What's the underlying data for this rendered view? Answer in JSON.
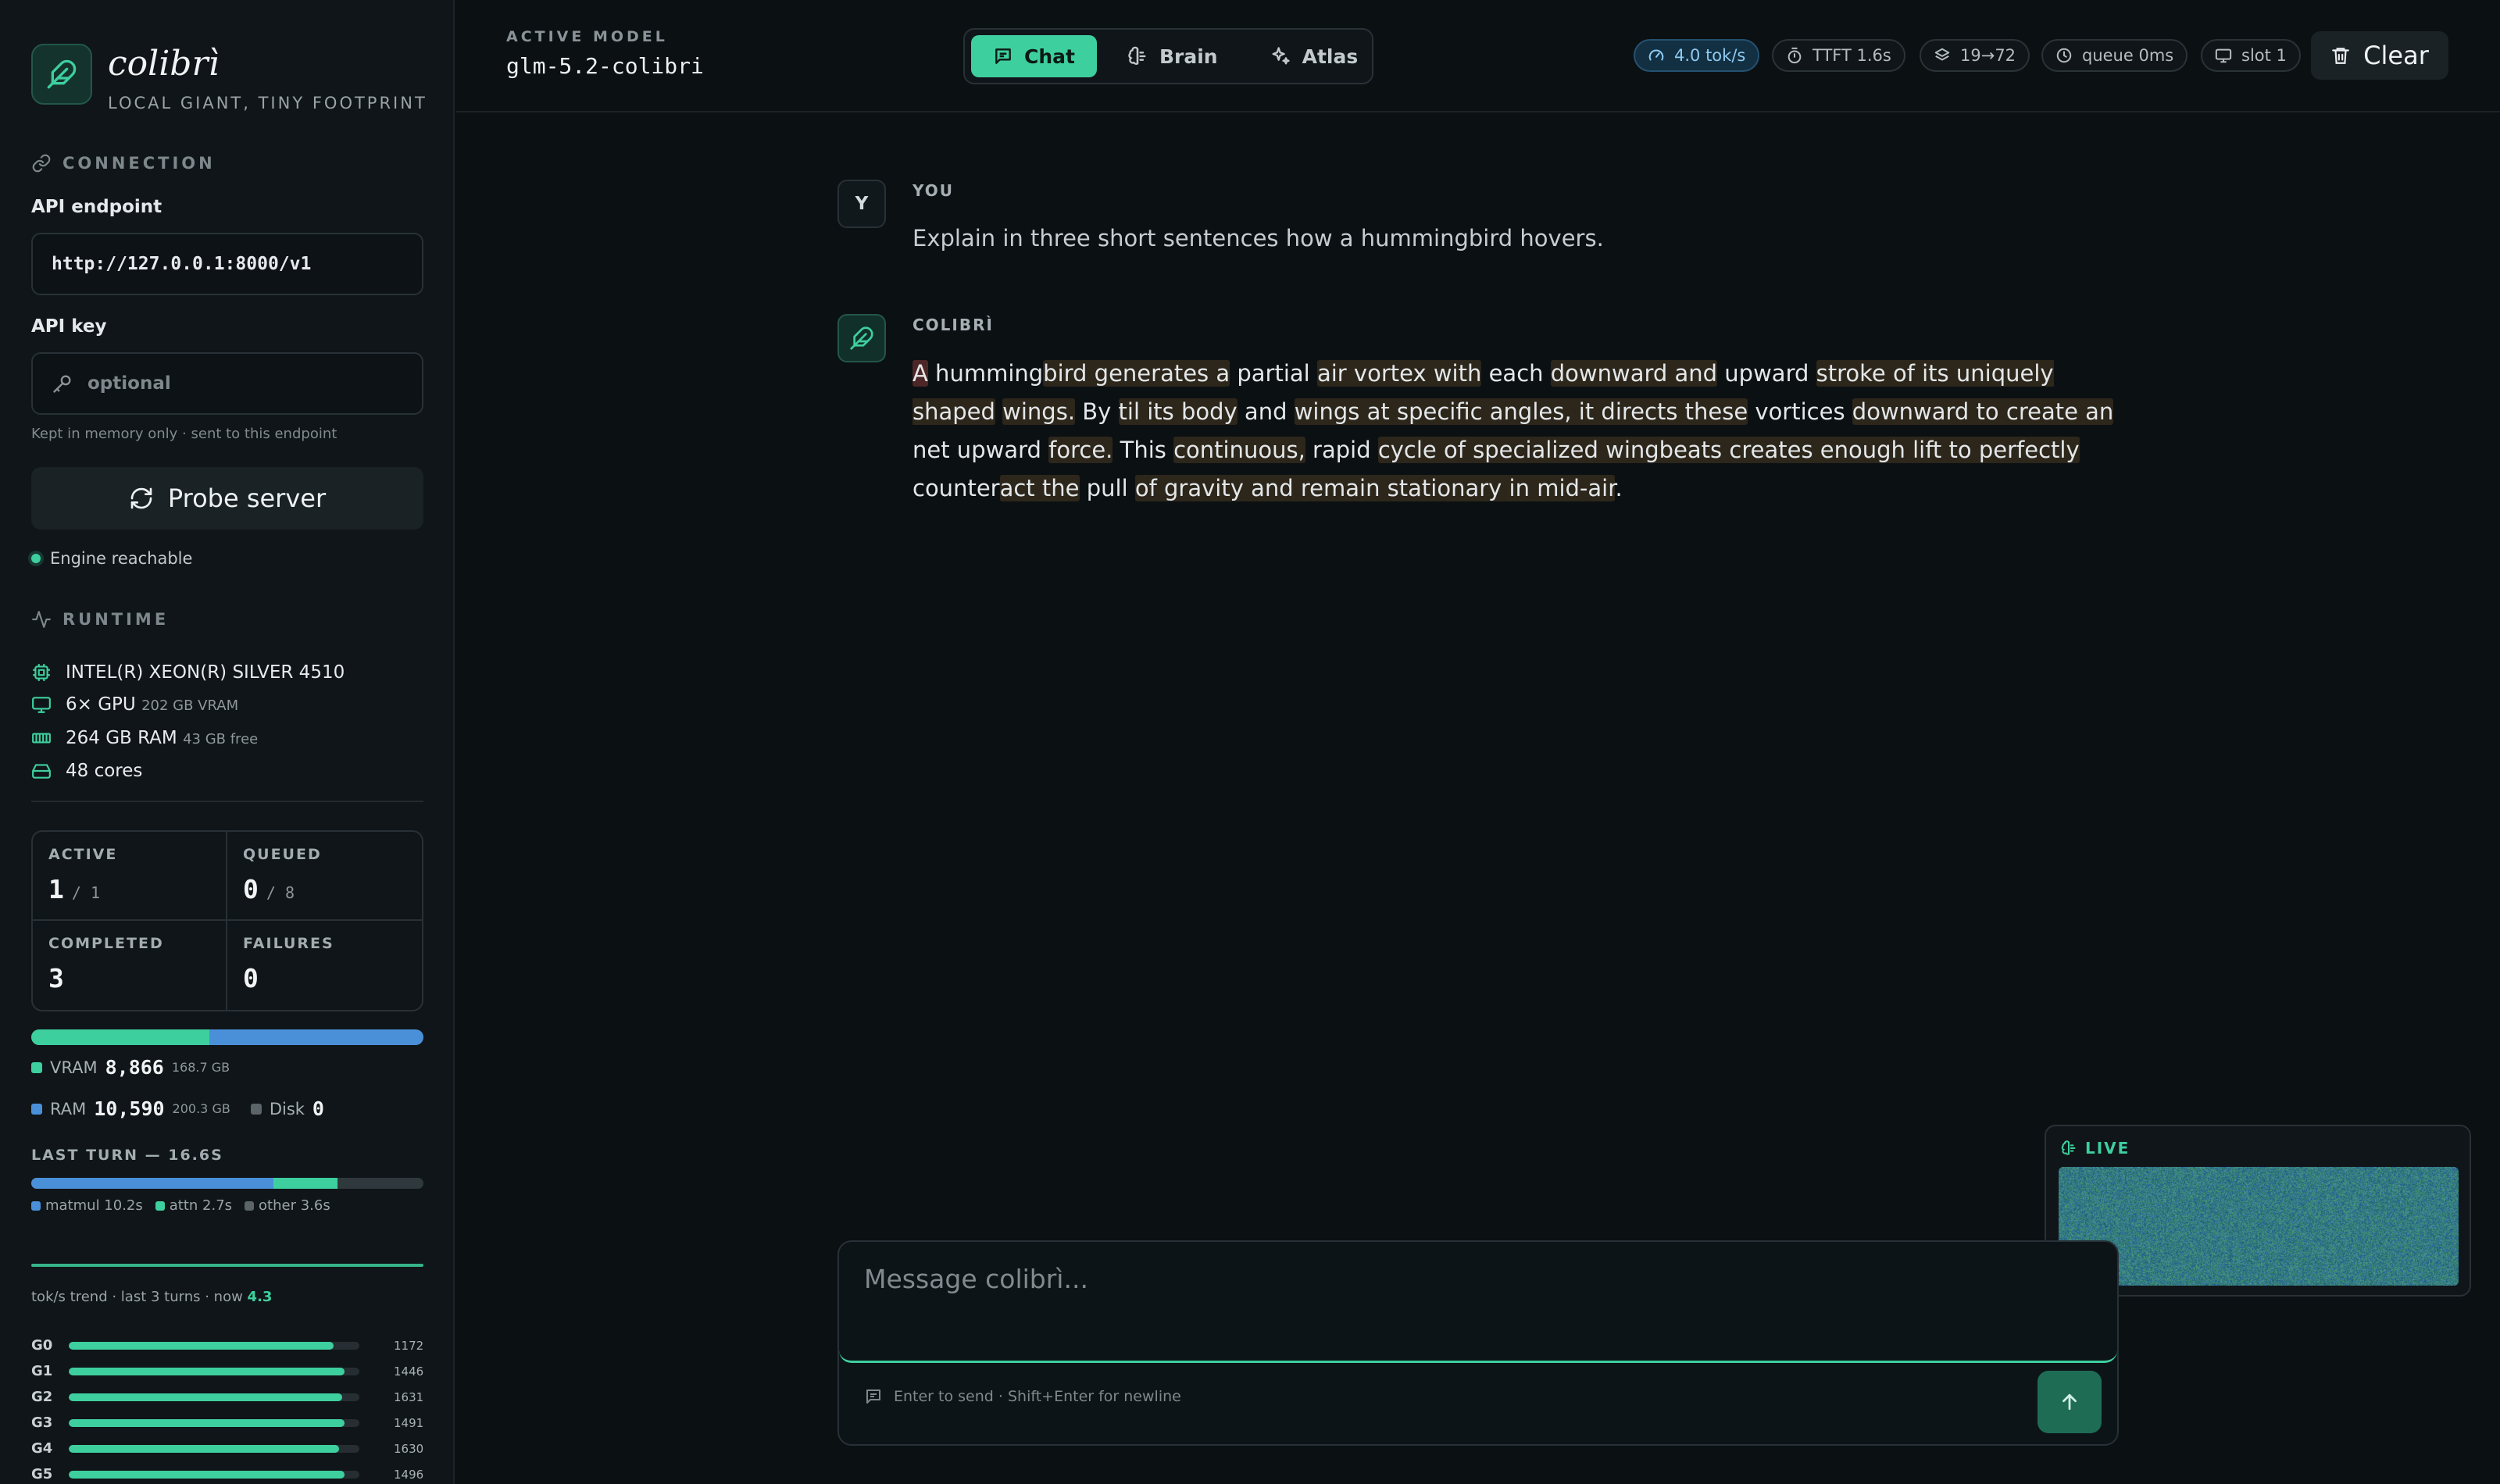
{
  "brand": {
    "name": "colibrì",
    "tagline": "LOCAL GIANT, TINY FOOTPRINT"
  },
  "connection": {
    "section_title": "CONNECTION",
    "endpoint_label": "API endpoint",
    "endpoint_value": "http://127.0.0.1:8000/v1",
    "key_label": "API key",
    "key_placeholder": "optional",
    "key_hint": "Kept in memory only · sent to this endpoint",
    "probe_label": "Probe server",
    "status_text": "Engine reachable"
  },
  "runtime": {
    "section_title": "RUNTIME",
    "cpu": "INTEL(R) XEON(R) SILVER 4510",
    "gpu": "6× GPU",
    "gpu_sub": "202 GB VRAM",
    "ram": "264 GB RAM",
    "ram_sub": "43 GB free",
    "cores": "48 cores"
  },
  "stats": {
    "active_label": "ACTIVE",
    "active_value": "1",
    "active_total": "/ 1",
    "queued_label": "QUEUED",
    "queued_value": "0",
    "queued_total": "/ 8",
    "completed_label": "COMPLETED",
    "completed_value": "3",
    "failures_label": "FAILURES",
    "failures_value": "0"
  },
  "memory": {
    "vram_label": "VRAM",
    "vram_value": "8,866",
    "vram_total": "168.7 GB",
    "ram_label": "RAM",
    "ram_value": "10,590",
    "ram_total": "200.3 GB",
    "disk_label": "Disk",
    "disk_value": "0",
    "vram_fraction": 0.455,
    "ram_fraction": 0.545
  },
  "last_turn": {
    "title": "LAST TURN — 16.6S",
    "matmul": "matmul 10.2s",
    "attn": "attn 2.7s",
    "other": "other 3.6s",
    "matmul_s": 10.2,
    "attn_s": 2.7,
    "other_s": 3.6
  },
  "trend": {
    "label": "tok/s trend · last 3 turns · now",
    "now": "4.3"
  },
  "gpus": [
    {
      "name": "G0",
      "value": "1172",
      "fill": 0.91
    },
    {
      "name": "G1",
      "value": "1446",
      "fill": 0.95
    },
    {
      "name": "G2",
      "value": "1631",
      "fill": 0.94
    },
    {
      "name": "G3",
      "value": "1491",
      "fill": 0.95
    },
    {
      "name": "G4",
      "value": "1630",
      "fill": 0.93
    },
    {
      "name": "G5",
      "value": "1496",
      "fill": 0.95
    }
  ],
  "header": {
    "model_label": "ACTIVE MODEL",
    "model_value": "glm-5.2-colibri",
    "tabs": [
      {
        "label": "Chat"
      },
      {
        "label": "Brain"
      },
      {
        "label": "Atlas"
      }
    ],
    "speed": "4.0 tok/s",
    "ttft": "TTFT 1.6s",
    "tokens": "19→72",
    "queue": "queue 0ms",
    "slot": "slot 1",
    "clear_label": "Clear"
  },
  "conversation": {
    "user_avatar": "Y",
    "user_name": "YOU",
    "user_text": "Explain in three short sentences how a hummingbird hovers.",
    "assistant_name": "COLIBRÌ"
  },
  "composer": {
    "placeholder": "Message colibrì...",
    "hint": "Enter to send · Shift+Enter for newline"
  },
  "live": {
    "label": "LIVE"
  },
  "colors": {
    "accent": "#3ecf9e",
    "ram": "#4a90d9",
    "disk": "#5b6469",
    "bg": "#0b1013"
  }
}
